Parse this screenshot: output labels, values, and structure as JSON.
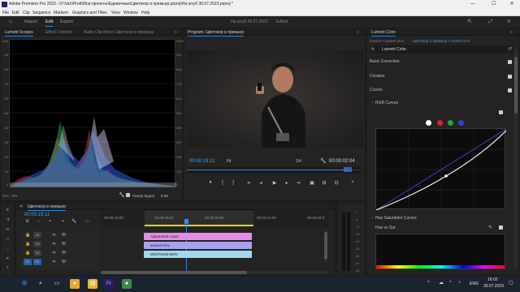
{
  "titlebar": {
    "title": "Adobe Premiere Pro 2023 - D:\\VaXiProd\\Мои проекты\\Единичные\\Цветокор в премьер.prproj\\На ютуб 30.07.2023.prproj *",
    "min": "—",
    "max": "☐",
    "close": "✕"
  },
  "menu": [
    "File",
    "Edit",
    "Clip",
    "Sequence",
    "Markers",
    "Graphics and Titles",
    "View",
    "Window",
    "Help"
  ],
  "workspace": {
    "tabs": [
      "Import",
      "Edit",
      "Export"
    ],
    "active_tab": "Edit",
    "doc_title": "На ютуб 30.07.2023",
    "doc_status": "Edited",
    "home_icon": "home-icon"
  },
  "scopes": {
    "tabs": [
      "Lumetri Scopes",
      "Effect Controls",
      "Audio Clip Mixer: Цветокор в премьер"
    ],
    "menu_glyph": "≡",
    "scale_left": [
      "100",
      "90",
      "80",
      "70",
      "60",
      "50",
      "40",
      "30",
      "20",
      "10",
      "0"
    ],
    "scale_right": [
      "1023",
      "921",
      "818",
      "716",
      "614",
      "511",
      "409",
      "307",
      "205",
      "102",
      "0"
    ],
    "footer_left": "Rec. 709",
    "clamp_label": "Clamp Signal",
    "bit_label": "8 Bit"
  },
  "program": {
    "tab_label": "Program: Цветокор в премьер",
    "menu_glyph": "≡",
    "timecode": "00:00:19:11",
    "fit": "Fit",
    "quality": "1/4",
    "duration": "00:00:02:04",
    "progress": 0.92
  },
  "lumetri": {
    "tab_label": "Lumetri Color",
    "source": "Source • хоскел.mov",
    "target": "Цветокор в премьер • хоскел.mov",
    "effect": "Lumetri Color",
    "sections": [
      "Basic Correction",
      "Creative",
      "Curves"
    ],
    "rgb_curves": "RGB Curves",
    "hue_sat_curves": "Hue Saturation Curves",
    "hue_vs_sat": "Hue vs Sat",
    "channel_colors": [
      "#ffffff",
      "#d9261c",
      "#1fa83a",
      "#2a45d6"
    ]
  },
  "timeline": {
    "tab_label": "Цветокор в премьер",
    "timecode": "00:00:19:11",
    "ruler": [
      "00:00:18:00",
      "00:00:19:00",
      "00:00:20:00",
      "00:00:21:00",
      "00:00:22:0"
    ],
    "tracks": [
      {
        "name": "V4",
        "btn": "V4"
      },
      {
        "name": "V3",
        "btn": "V3"
      },
      {
        "name": "V2",
        "btn": "V2"
      },
      {
        "name": "V1",
        "btn": "V1"
      }
    ],
    "clips": [
      {
        "label": "Adjustment Layer",
        "color": "#e38ee3"
      },
      {
        "label": "хоскел.mov",
        "color": "#a9a3ee"
      },
      {
        "label": "DSCF6440.MOV",
        "color": "#9ed7ee"
      }
    ],
    "meter_scale": [
      "0",
      "-6",
      "-12",
      "-18",
      "-24",
      "-30",
      "-36",
      "-42",
      "-48"
    ]
  },
  "taskbar": {
    "lang": "ENG",
    "time": "16:02",
    "date": "30.07.2023"
  }
}
